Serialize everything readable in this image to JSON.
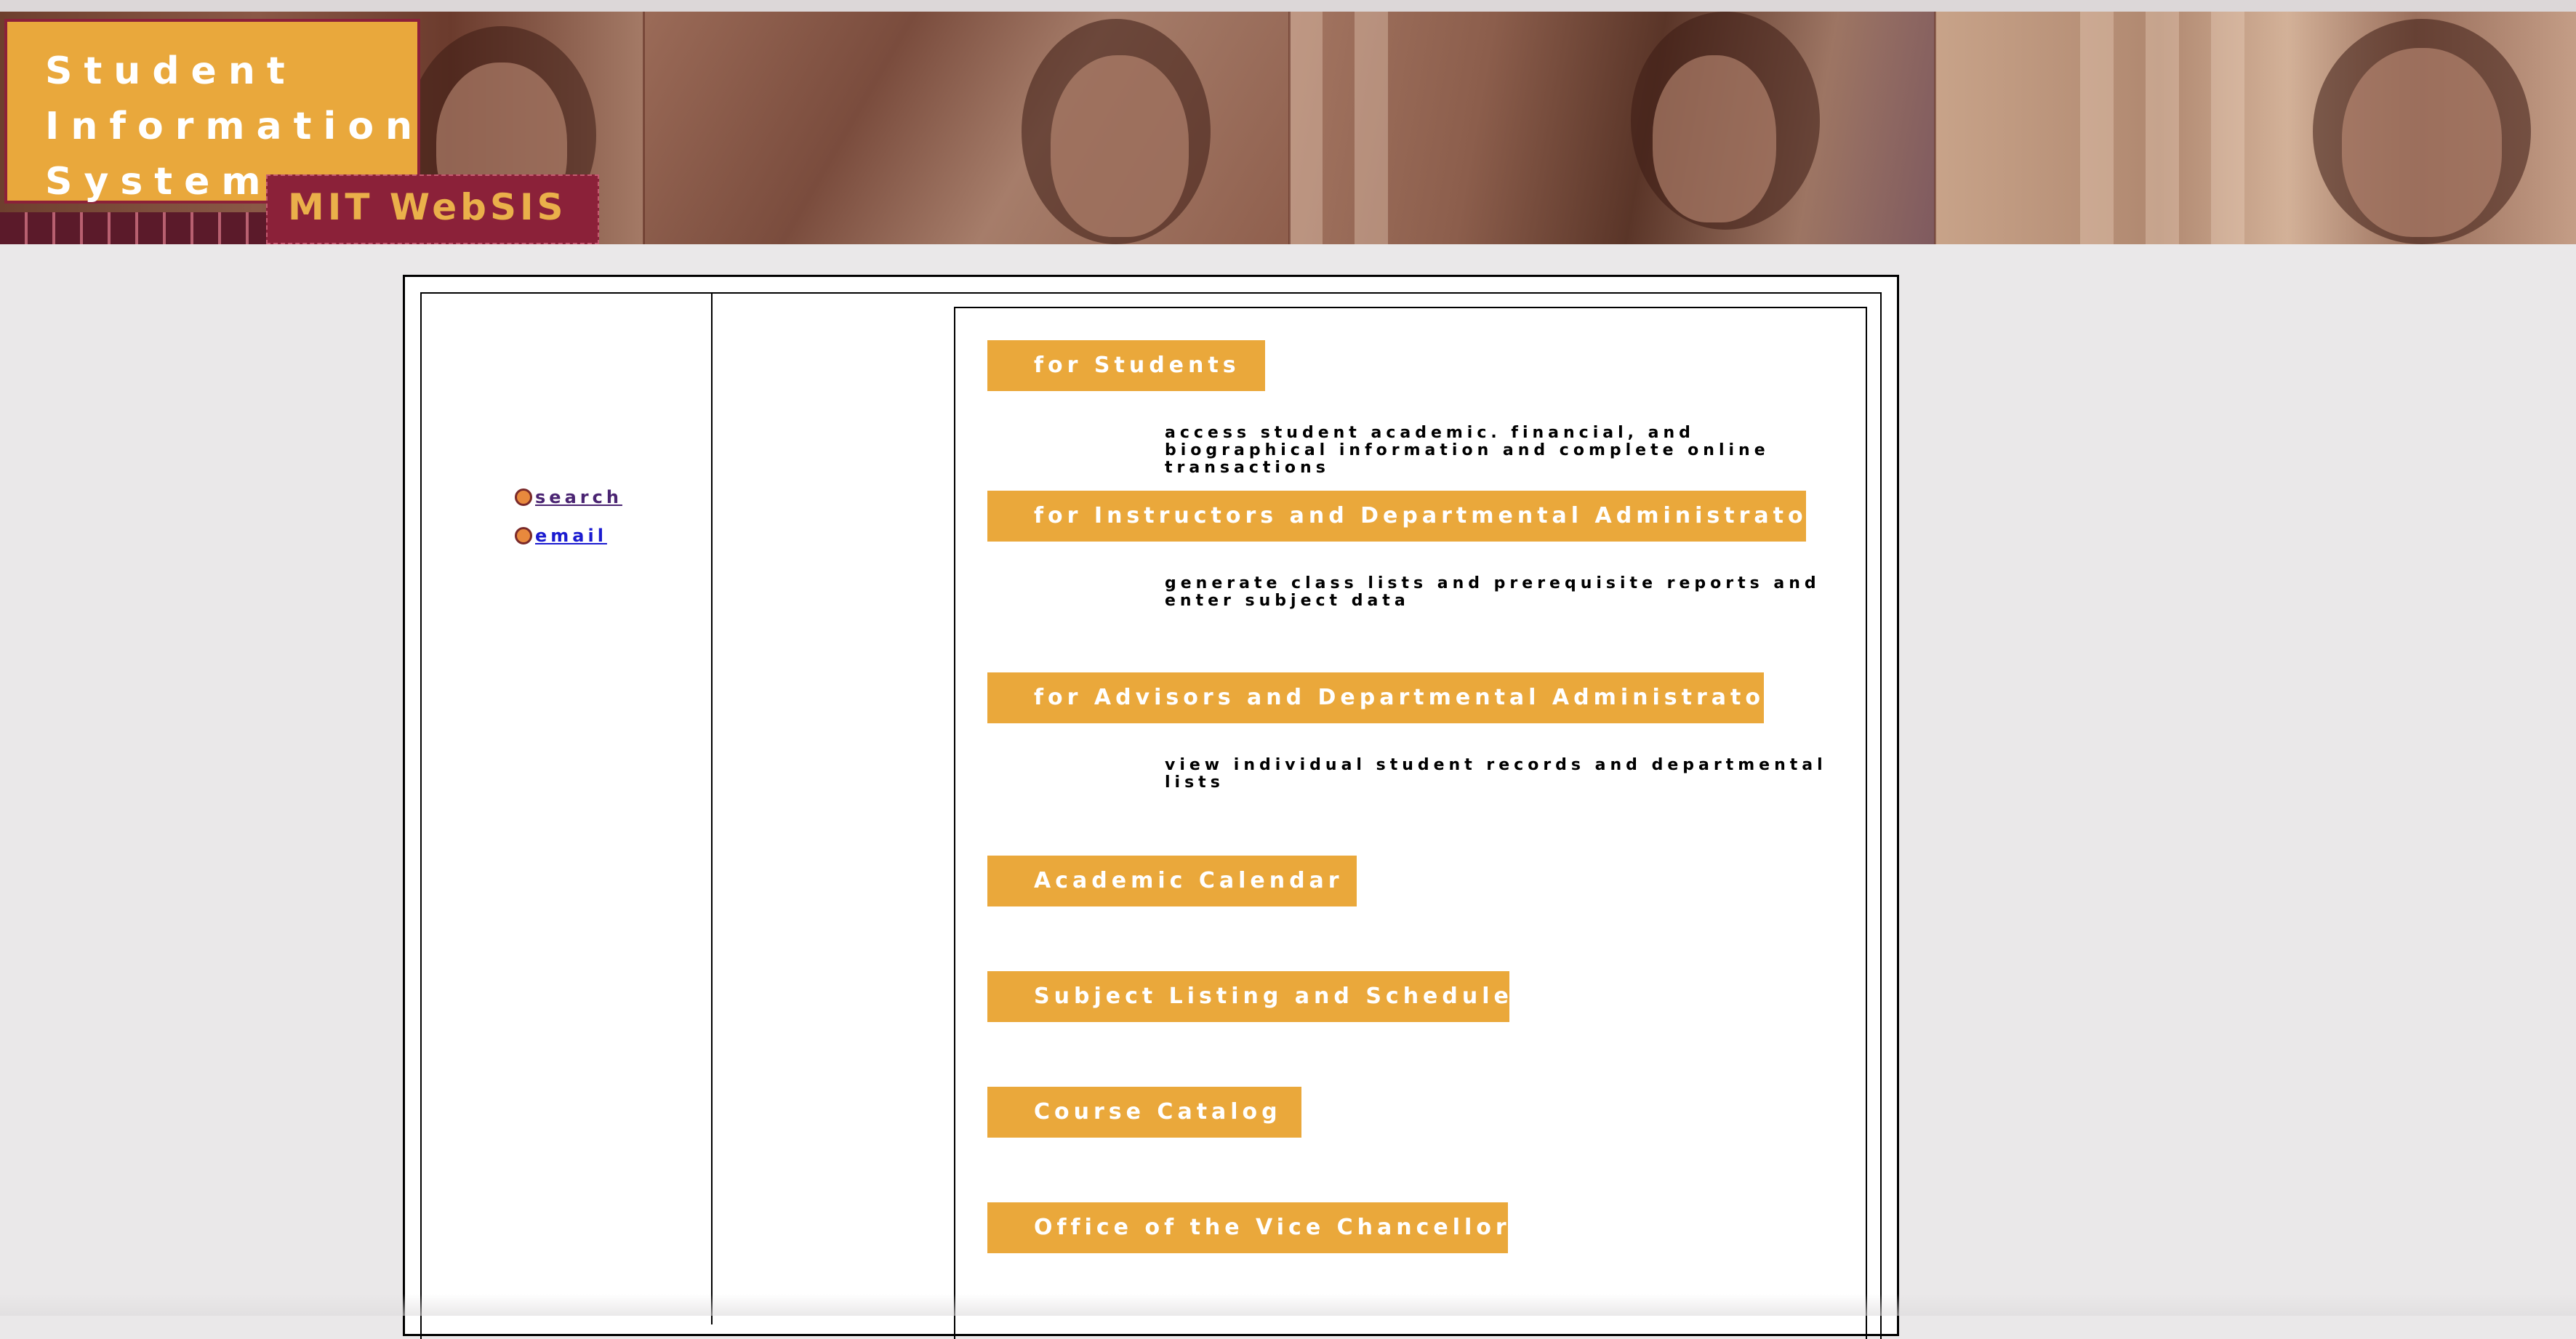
{
  "header": {
    "logo_title": "Student\nInformation\nSystem",
    "logo_subtitle": "MIT WebSIS"
  },
  "sidebar": {
    "links": [
      {
        "label": "search"
      },
      {
        "label": "email"
      }
    ]
  },
  "sections": [
    {
      "label": "for Students",
      "description": "access student academic. financial, and biographical information and complete online transactions"
    },
    {
      "label": "for Instructors and Departmental Administrators",
      "description": "generate class lists and prerequisite reports and enter subject data"
    },
    {
      "label": "for Advisors and Departmental Administrators",
      "description": "view individual student records and departmental lists"
    },
    {
      "label": "Academic Calendar"
    },
    {
      "label": "Subject Listing and Schedule"
    },
    {
      "label": "Course Catalog"
    },
    {
      "label": "Office of the Vice Chancellor"
    }
  ],
  "colors": {
    "accent_orange": "#eaa83b",
    "maroon": "#8b2139",
    "page_background": "#eae8e9"
  }
}
